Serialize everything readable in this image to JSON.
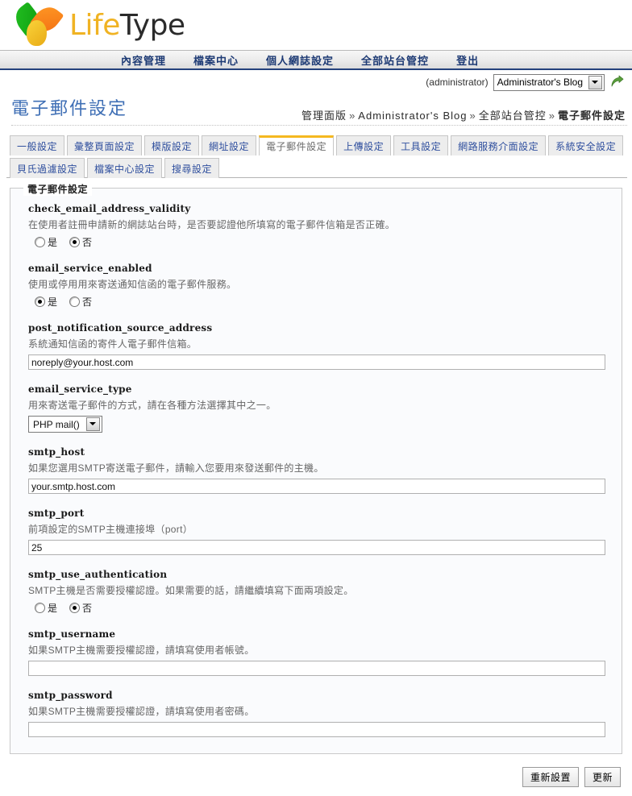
{
  "brand": {
    "name_part1": "Life",
    "name_part2": "Type",
    "logo_icon": "three-leaf-logo"
  },
  "mainnav": {
    "items": [
      {
        "label": "內容管理"
      },
      {
        "label": "檔案中心"
      },
      {
        "label": "個人網誌設定"
      },
      {
        "label": "全部站台管控"
      },
      {
        "label": "登出"
      }
    ]
  },
  "userbar": {
    "user": "(administrator)",
    "blog_selected": "Administrator's Blog",
    "go_icon": "green-go-arrow-icon",
    "dropdown_icon": "chevron-down-icon"
  },
  "page": {
    "title": "電子郵件設定",
    "breadcrumb": [
      "管理面版",
      "Administrator's Blog",
      "全部站台管控",
      "電子郵件設定"
    ],
    "breadcrumb_separator": "»"
  },
  "tabs": [
    {
      "label": "一般設定",
      "active": false
    },
    {
      "label": "彙整頁面設定",
      "active": false
    },
    {
      "label": "模版設定",
      "active": false
    },
    {
      "label": "網址設定",
      "active": false
    },
    {
      "label": "電子郵件設定",
      "active": true
    },
    {
      "label": "上傳設定",
      "active": false
    },
    {
      "label": "工具設定",
      "active": false
    },
    {
      "label": "網路服務介面設定",
      "active": false
    },
    {
      "label": "系統安全設定",
      "active": false
    },
    {
      "label": "貝氏過濾設定",
      "active": false
    },
    {
      "label": "檔案中心設定",
      "active": false
    },
    {
      "label": "搜尋設定",
      "active": false
    }
  ],
  "panel": {
    "legend": "電子郵件設定",
    "fields": [
      {
        "name": "check_email_address_validity",
        "desc": "在使用者註冊申請新的網誌站台時，是否要認證他所填寫的電子郵件信箱是否正確。",
        "type": "radio",
        "options": [
          {
            "label": "是",
            "checked": false
          },
          {
            "label": "否",
            "checked": true
          }
        ]
      },
      {
        "name": "email_service_enabled",
        "desc": "使用或停用用來寄送通知信函的電子郵件服務。",
        "type": "radio",
        "options": [
          {
            "label": "是",
            "checked": true
          },
          {
            "label": "否",
            "checked": false
          }
        ]
      },
      {
        "name": "post_notification_source_address",
        "desc": "系統通知信函的寄件人電子郵件信箱。",
        "type": "text",
        "value": "noreply@your.host.com"
      },
      {
        "name": "email_service_type",
        "desc": "用來寄送電子郵件的方式，請在各種方法選擇其中之一。",
        "type": "select",
        "value": "PHP mail()"
      },
      {
        "name": "smtp_host",
        "desc": "如果您選用SMTP寄送電子郵件，請輸入您要用來發送郵件的主機。",
        "type": "text",
        "value": "your.smtp.host.com"
      },
      {
        "name": "smtp_port",
        "desc": "前項設定的SMTP主機連接埠（port）",
        "type": "text",
        "value": "25"
      },
      {
        "name": "smtp_use_authentication",
        "desc": "SMTP主機是否需要授權認證。如果需要的話，請繼續填寫下面兩項設定。",
        "type": "radio",
        "options": [
          {
            "label": "是",
            "checked": false
          },
          {
            "label": "否",
            "checked": true
          }
        ]
      },
      {
        "name": "smtp_username",
        "desc": "如果SMTP主機需要授權認證，請填寫使用者帳號。",
        "type": "text",
        "value": ""
      },
      {
        "name": "smtp_password",
        "desc": "如果SMTP主機需要授權認證，請填寫使用者密碼。",
        "type": "text",
        "value": ""
      }
    ]
  },
  "footer": {
    "reset_label": "重新設置",
    "update_label": "更新"
  },
  "colors": {
    "accent_tab": "#f5b820",
    "nav_blue": "#24417c",
    "title_blue": "#3f6fb5",
    "logo_yellow": "#f0b323"
  }
}
